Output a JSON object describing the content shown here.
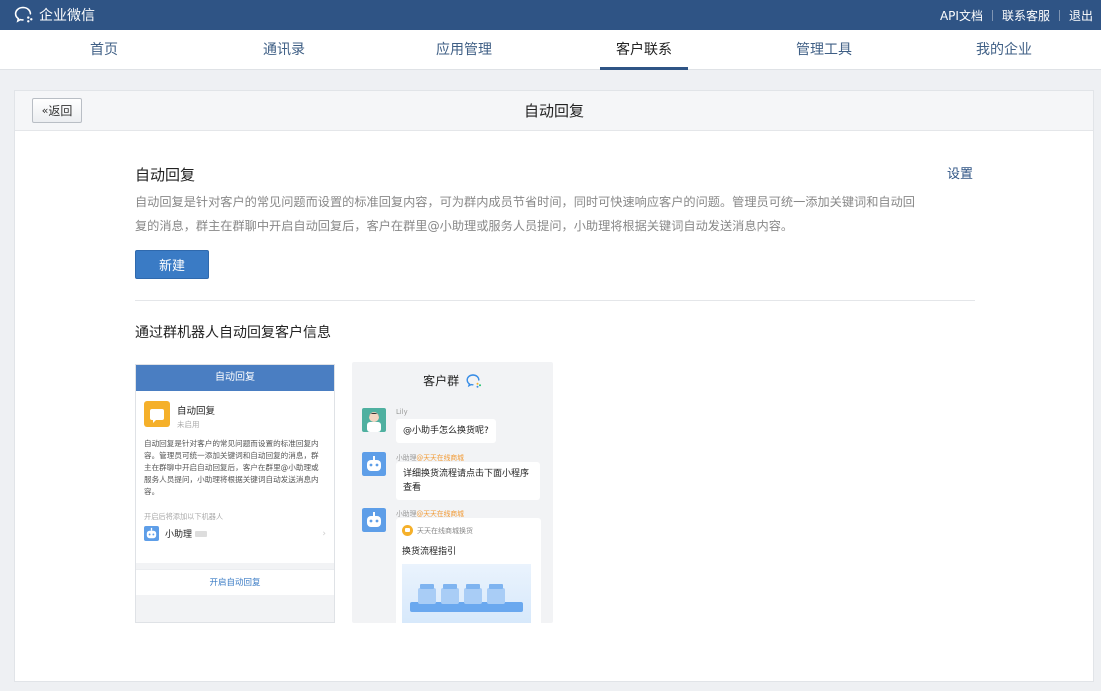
{
  "topbar": {
    "brand": "企业微信",
    "links": [
      "API文档",
      "联系客服",
      "退出"
    ]
  },
  "nav": {
    "items": [
      "首页",
      "通讯录",
      "应用管理",
      "客户联系",
      "管理工具",
      "我的企业"
    ],
    "active": "客户联系"
  },
  "card": {
    "back_label": "返回",
    "title": "自动回复",
    "section_title": "自动回复",
    "settings_label": "设置",
    "description": "自动回复是针对客户的常见问题而设置的标准回复内容，可为群内成员节省时间，同时可快速响应客户的问题。管理员可统一添加关键词和自动回复的消息，群主在群聊中开启自动回复后，客户在群里@小助理或服务人员提问，小助理将根据关键词自动发送消息内容。",
    "new_button": "新建",
    "sub_title": "通过群机器人自动回复客户信息"
  },
  "preview1": {
    "header": "自动回复",
    "name": "自动回复",
    "status": "未启用",
    "desc": "自动回复是针对客户的常见问题而设置的标准回复内容。管理员可统一添加关键词和自动回复的消息，群主在群聊中开启自动回复后，客户在群里@小助理或服务人员提问，小助理将根据关键词自动发送消息内容。",
    "hint": "开启后将添加以下机器人",
    "bot_name": "小助理",
    "action": "开启自动回复"
  },
  "preview2": {
    "title": "客户群",
    "msg1_sender": "Lily",
    "msg1_text": "@小助手怎么换货呢?",
    "msg2_sender": "小助理",
    "msg2_org": "@天天在线商城",
    "msg2_text": "详细换货流程请点击下面小程序查看",
    "msg3_sender": "小助理",
    "msg3_org": "@天天在线商城",
    "mini_app_name": "天天在线商城换货",
    "mini_app_title": "换货流程指引"
  },
  "colors": {
    "topbar": "#2f5485",
    "primary_button": "#3a7bc5",
    "link": "#2f5485",
    "accent_orange": "#f29c38"
  }
}
